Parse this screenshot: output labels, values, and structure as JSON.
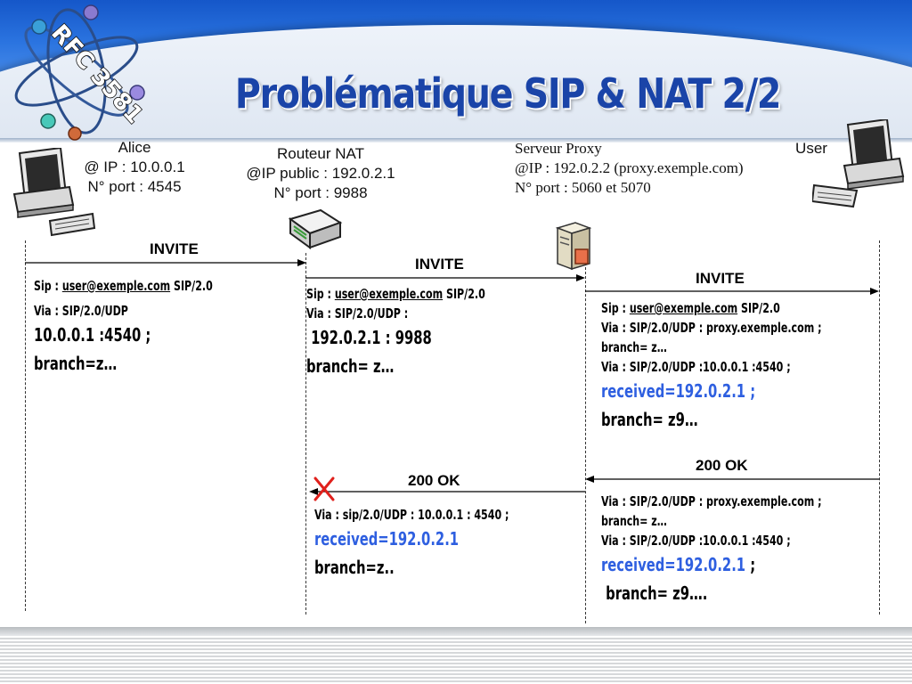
{
  "slide": {
    "title": "Problématique SIP & NAT 2/2",
    "logo_text": "RFC 3581"
  },
  "entities": {
    "alice": {
      "name": "Alice",
      "ip": "@ IP : 10.0.0.1",
      "port": "N° port : 4545"
    },
    "nat": {
      "name": "Routeur NAT",
      "ip": "@IP public : 192.0.2.1",
      "port": "N° port : 9988"
    },
    "proxy": {
      "name": "Serveur Proxy",
      "ip": "@IP : 192.0.2.2 (proxy.exemple.com)",
      "port": "N° port : 5060 et 5070"
    },
    "user": {
      "name": "User"
    }
  },
  "messages": {
    "invite_1": "INVITE",
    "invite_2": "INVITE",
    "invite_3": "INVITE",
    "ok_1": "200 OK",
    "ok_2": "200 OK"
  },
  "blocks": {
    "alice_invite": {
      "sip_prefix": "Sip : ",
      "sip_uri": "user@exemple.com",
      "sip_suffix": " SIP/2.0",
      "via": "Via : SIP/2.0/UDP",
      "addr": "10.0.0.1 :4540 ;",
      "branch": "branch=z…"
    },
    "nat_invite": {
      "sip_prefix": "Sip : ",
      "sip_uri": "user@exemple.com",
      "sip_suffix": " SIP/2.0",
      "via": "Via : SIP/2.0/UDP :",
      "addr": " 192.0.2.1 : 9988",
      "branch": "branch= z…"
    },
    "proxy_invite": {
      "sip_prefix": "Sip : ",
      "sip_uri": "user@exemple.com",
      "sip_suffix": " SIP/2.0",
      "via1": "Via : SIP/2.0/UDP : proxy.exemple.com ;",
      "branch1": "branch= z…",
      "via2": "Via : SIP/2.0/UDP :10.0.0.1 :4540 ;",
      "received": "received=192.0.2.1 ;",
      "branch2": "branch= z9…"
    },
    "user_ok": {
      "via1": "Via : SIP/2.0/UDP : proxy.exemple.com ;",
      "branch1": "branch= z…",
      "via2": "Via : SIP/2.0/UDP :10.0.0.1 :4540 ;",
      "received": "received=192.0.2.1",
      "received_suffix": " ;",
      "branch2": " branch= z9…."
    },
    "proxy_ok": {
      "via": "Via : sip/2.0/UDP : 10.0.0.1 : 4540 ;",
      "received": "received=192.0.2.1",
      "branch": "branch=z.."
    }
  },
  "colors": {
    "title": "#1a44a8",
    "received": "#2e5fe0",
    "blocked_marker": "#e0201c",
    "banner": "#2b74e0"
  },
  "icons": {
    "alice": "computer-icon",
    "nat": "router-icon",
    "proxy": "server-icon",
    "user": "computer-icon",
    "blocked": "red-x-icon"
  }
}
